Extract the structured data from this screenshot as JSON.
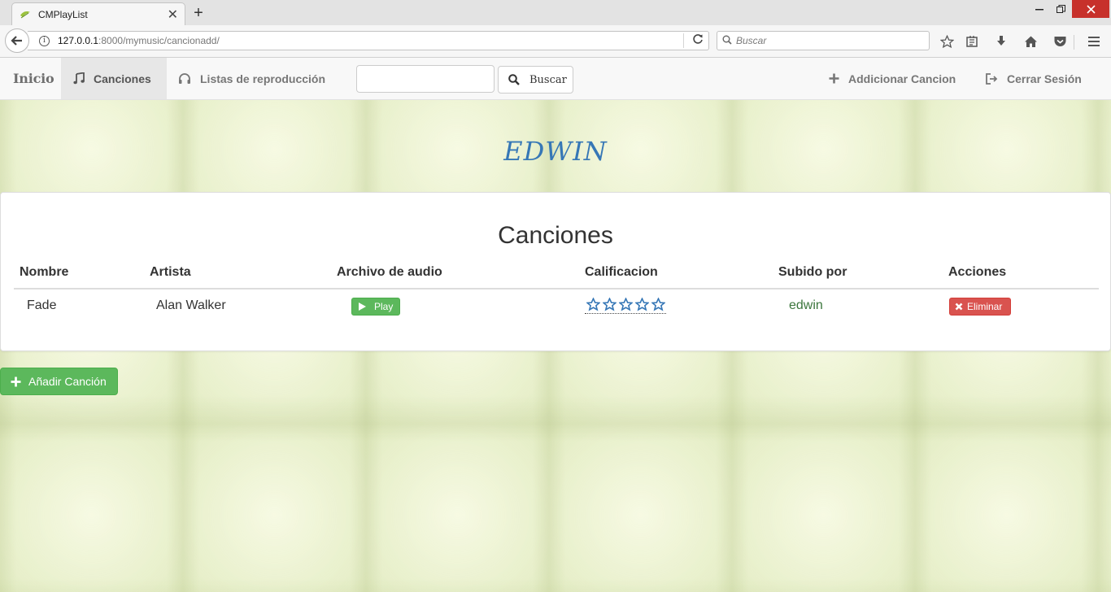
{
  "browser": {
    "tab_title": "CMPlayList",
    "url_host": "127.0.0.1",
    "url_path": ":8000/mymusic/cancionadd/",
    "search_placeholder": "Buscar"
  },
  "nav": {
    "brand": "Inicio",
    "canciones": "Canciones",
    "listas": "Listas de reproducción",
    "search_value": "",
    "search_button": "Buscar",
    "add_song": "Addicionar Cancion",
    "logout": "Cerrar Sesión"
  },
  "user": {
    "name": "EDWIN"
  },
  "songs_panel": {
    "title": "Canciones",
    "columns": [
      "Nombre",
      "Artista",
      "Archivo de audio",
      "Calificacion",
      "Subido por",
      "Acciones"
    ],
    "rows": [
      {
        "nombre": "Fade",
        "artista": "Alan Walker",
        "play_label": "Play",
        "rating": 0,
        "rating_max": 5,
        "subido_por": "edwin",
        "delete_label": "Eliminar"
      }
    ]
  },
  "add_button": "Añadir Canción",
  "colors": {
    "accent_blue": "#3677b6",
    "success": "#5cb85c",
    "danger": "#d9534f",
    "uploader_text": "#3c763d"
  }
}
